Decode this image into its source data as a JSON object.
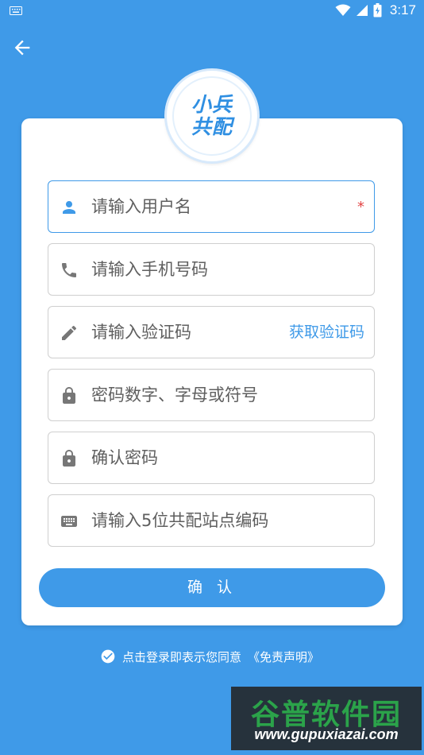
{
  "status_bar": {
    "time": "3:17",
    "icons": [
      "keyboard-icon",
      "wifi-icon",
      "signal-icon",
      "battery-icon"
    ]
  },
  "header": {
    "back_icon": "arrow-left-icon"
  },
  "logo": {
    "line1": "小兵",
    "line2": "共配"
  },
  "form": {
    "username": {
      "placeholder": "请输入用户名",
      "required_mark": "*",
      "icon": "person-icon"
    },
    "phone": {
      "placeholder": "请输入手机号码",
      "icon": "phone-icon"
    },
    "code": {
      "placeholder": "请输入验证码",
      "action_label": "获取验证码",
      "icon": "pencil-icon"
    },
    "password": {
      "placeholder": "密码数字、字母或符号",
      "icon": "lock-icon"
    },
    "confirm_password": {
      "placeholder": "确认密码",
      "icon": "lock-icon"
    },
    "station_code": {
      "placeholder": "请输入5位共配站点编码",
      "icon": "keyboard-icon"
    }
  },
  "confirm_button": {
    "label": "确 认"
  },
  "agreement": {
    "text": "点击登录即表示您同意",
    "link": "《免责声明》",
    "icon": "check-circle-icon"
  },
  "watermark": {
    "title": "谷普软件园",
    "url": "www.gupuxiazai.com"
  },
  "colors": {
    "primary": "#3f9ae8",
    "required": "#e24545",
    "watermark_green": "#2ba34a"
  }
}
